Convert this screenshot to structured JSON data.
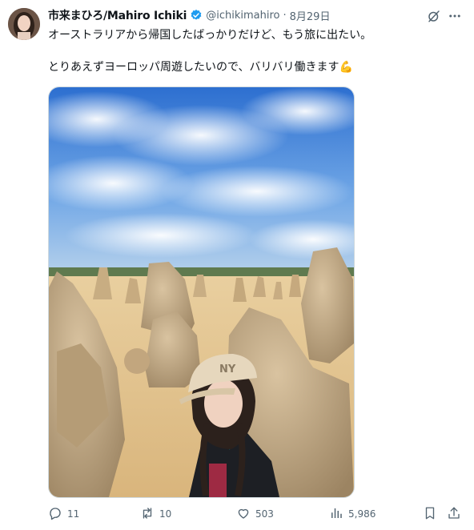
{
  "tweet": {
    "display_name": "市来まひろ/Mahiro Ichiki",
    "handle": "@ichikimahiro",
    "separator": "·",
    "date": "8月29日",
    "text_line1": "オーストラリアから帰国したばっかりだけど、もう旅に出たい。",
    "text_line2": "とりあえずヨーロッパ周遊したいので、バリバリ働きます",
    "emoji": "💪",
    "media_cap_text": "NY"
  },
  "stats": {
    "replies": "11",
    "reposts": "10",
    "likes": "503",
    "views": "5,986"
  },
  "colors": {
    "text": "#0f1419",
    "secondary": "#536471",
    "verified": "#1d9bf0",
    "border": "#cfd9de"
  }
}
